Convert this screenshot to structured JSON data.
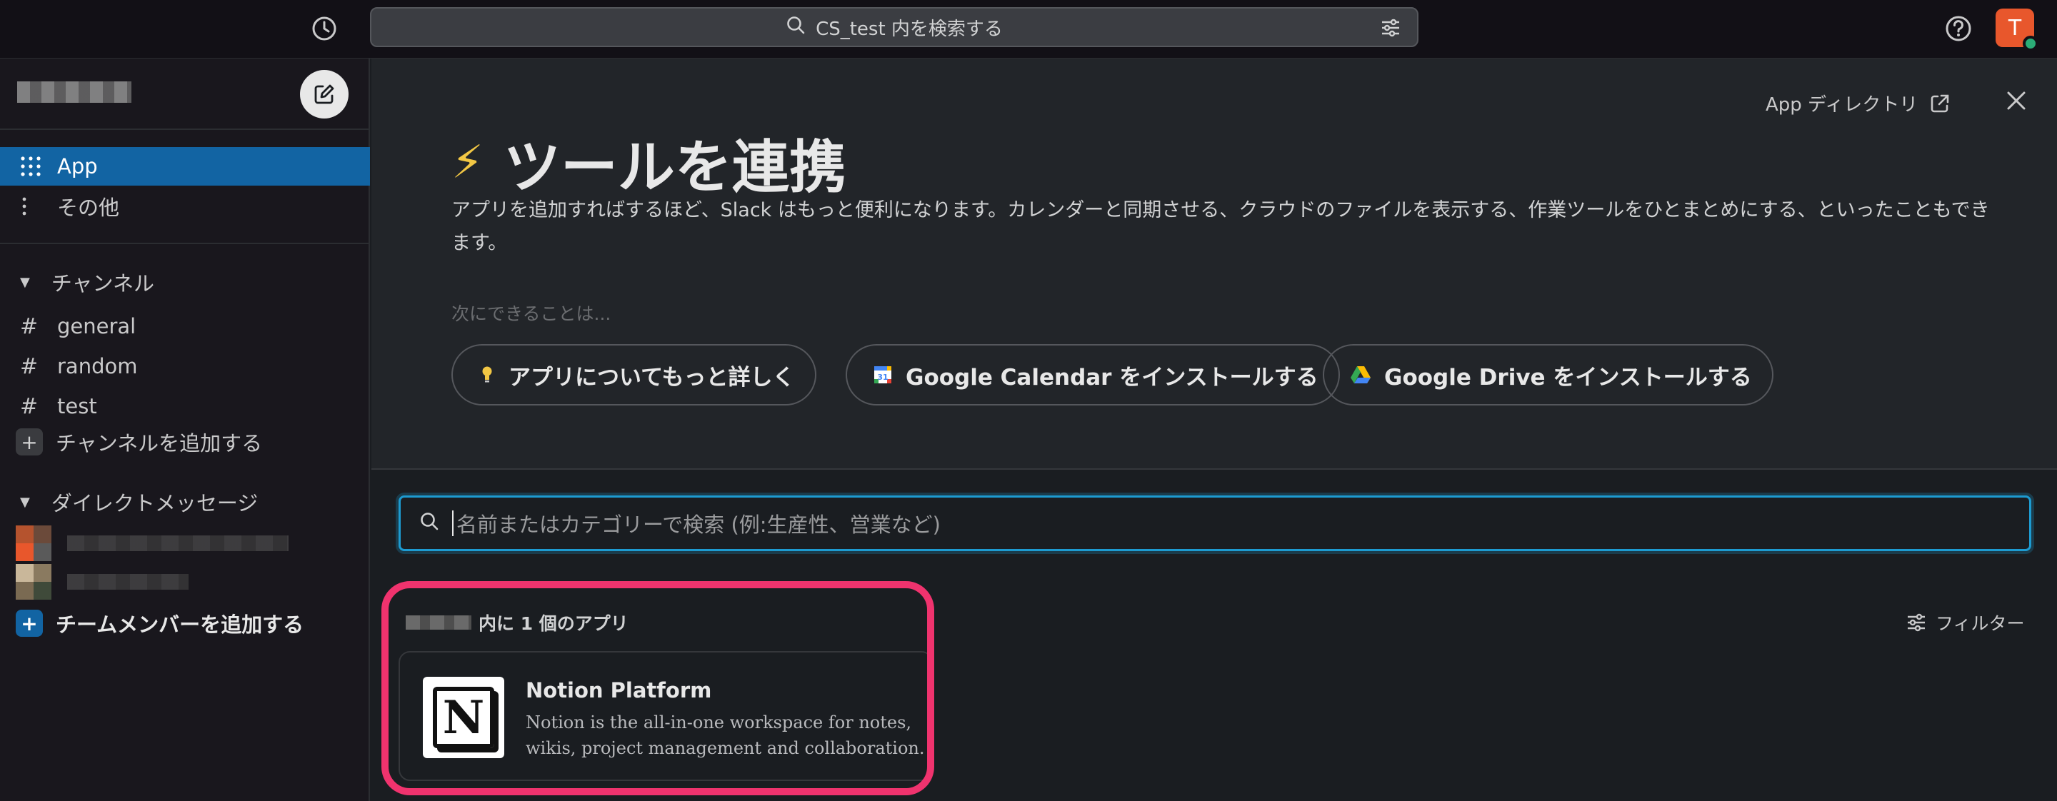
{
  "topbar": {
    "search_label": "CS_test 内を検索する",
    "avatar_initial": "T",
    "avatar_color": "#e8572c"
  },
  "sidebar": {
    "items": [
      {
        "label": "App",
        "icon": "grid-icon"
      },
      {
        "label": "その他",
        "icon": "more-vertical-icon"
      }
    ],
    "channels_header": "チャンネル",
    "channels": [
      "general",
      "random",
      "test"
    ],
    "add_channel": "チャンネルを追加する",
    "dm_header": "ダイレクトメッセージ",
    "add_member": "チームメンバーを追加する"
  },
  "main": {
    "app_directory": "App ディレクトリ",
    "title": "ツールを連携",
    "description": "アプリを追加すればするほど、Slack はもっと便利になります。カレンダーと同期させる、クラウドのファイルを表示する、作業ツールをひとまとめにする、といったこともできます。",
    "next_label": "次にできることは...",
    "pills": [
      "アプリについてもっと詳しく",
      "Google Calendar をインストールする",
      "Google Drive をインストールする"
    ],
    "search_placeholder": "名前またはカテゴリーで検索 (例:生産性、営業など)",
    "result_count": "内に 1 個のアプリ",
    "filter_label": "フィルター",
    "app": {
      "name": "Notion Platform",
      "description": "Notion is the all-in-one workspace for notes, wikis, project management and collaboration.",
      "logo_letter": "N"
    },
    "highlight_color": "#f0336e",
    "accent_color": "#1264a3"
  }
}
